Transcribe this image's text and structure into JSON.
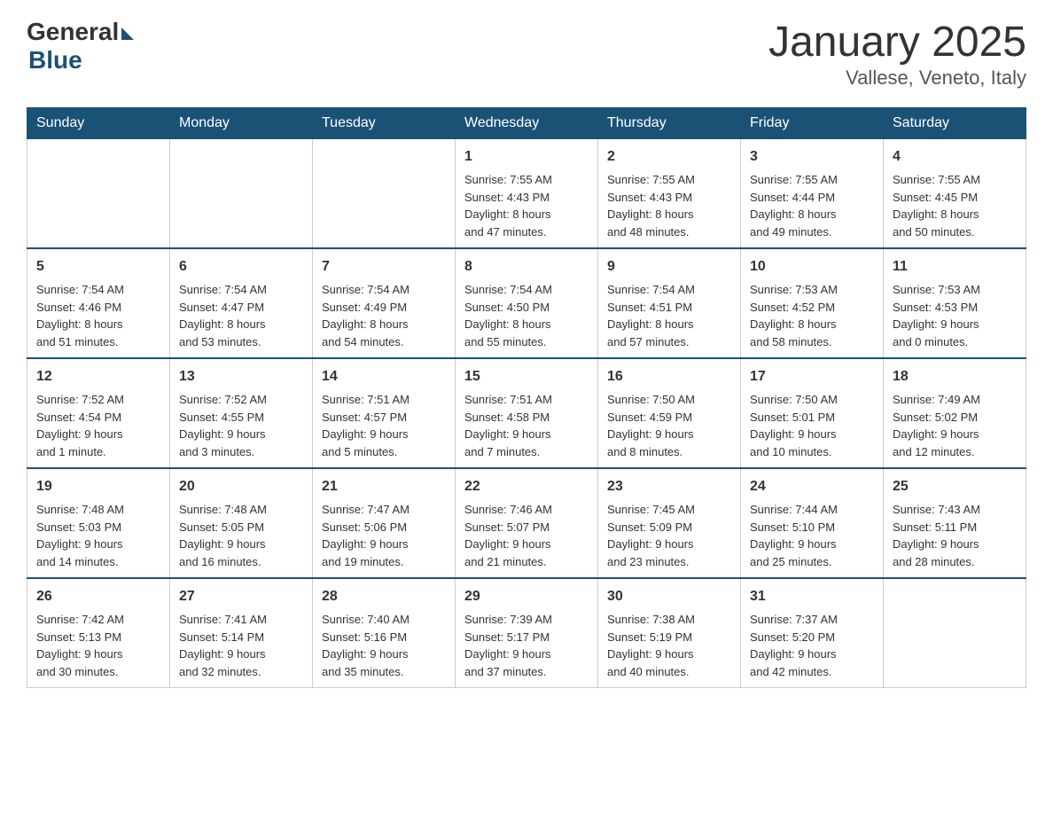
{
  "logo": {
    "general": "General",
    "blue": "Blue"
  },
  "title": "January 2025",
  "subtitle": "Vallese, Veneto, Italy",
  "days": [
    "Sunday",
    "Monday",
    "Tuesday",
    "Wednesday",
    "Thursday",
    "Friday",
    "Saturday"
  ],
  "weeks": [
    [
      {
        "day": "",
        "info": ""
      },
      {
        "day": "",
        "info": ""
      },
      {
        "day": "",
        "info": ""
      },
      {
        "day": "1",
        "info": "Sunrise: 7:55 AM\nSunset: 4:43 PM\nDaylight: 8 hours\nand 47 minutes."
      },
      {
        "day": "2",
        "info": "Sunrise: 7:55 AM\nSunset: 4:43 PM\nDaylight: 8 hours\nand 48 minutes."
      },
      {
        "day": "3",
        "info": "Sunrise: 7:55 AM\nSunset: 4:44 PM\nDaylight: 8 hours\nand 49 minutes."
      },
      {
        "day": "4",
        "info": "Sunrise: 7:55 AM\nSunset: 4:45 PM\nDaylight: 8 hours\nand 50 minutes."
      }
    ],
    [
      {
        "day": "5",
        "info": "Sunrise: 7:54 AM\nSunset: 4:46 PM\nDaylight: 8 hours\nand 51 minutes."
      },
      {
        "day": "6",
        "info": "Sunrise: 7:54 AM\nSunset: 4:47 PM\nDaylight: 8 hours\nand 53 minutes."
      },
      {
        "day": "7",
        "info": "Sunrise: 7:54 AM\nSunset: 4:49 PM\nDaylight: 8 hours\nand 54 minutes."
      },
      {
        "day": "8",
        "info": "Sunrise: 7:54 AM\nSunset: 4:50 PM\nDaylight: 8 hours\nand 55 minutes."
      },
      {
        "day": "9",
        "info": "Sunrise: 7:54 AM\nSunset: 4:51 PM\nDaylight: 8 hours\nand 57 minutes."
      },
      {
        "day": "10",
        "info": "Sunrise: 7:53 AM\nSunset: 4:52 PM\nDaylight: 8 hours\nand 58 minutes."
      },
      {
        "day": "11",
        "info": "Sunrise: 7:53 AM\nSunset: 4:53 PM\nDaylight: 9 hours\nand 0 minutes."
      }
    ],
    [
      {
        "day": "12",
        "info": "Sunrise: 7:52 AM\nSunset: 4:54 PM\nDaylight: 9 hours\nand 1 minute."
      },
      {
        "day": "13",
        "info": "Sunrise: 7:52 AM\nSunset: 4:55 PM\nDaylight: 9 hours\nand 3 minutes."
      },
      {
        "day": "14",
        "info": "Sunrise: 7:51 AM\nSunset: 4:57 PM\nDaylight: 9 hours\nand 5 minutes."
      },
      {
        "day": "15",
        "info": "Sunrise: 7:51 AM\nSunset: 4:58 PM\nDaylight: 9 hours\nand 7 minutes."
      },
      {
        "day": "16",
        "info": "Sunrise: 7:50 AM\nSunset: 4:59 PM\nDaylight: 9 hours\nand 8 minutes."
      },
      {
        "day": "17",
        "info": "Sunrise: 7:50 AM\nSunset: 5:01 PM\nDaylight: 9 hours\nand 10 minutes."
      },
      {
        "day": "18",
        "info": "Sunrise: 7:49 AM\nSunset: 5:02 PM\nDaylight: 9 hours\nand 12 minutes."
      }
    ],
    [
      {
        "day": "19",
        "info": "Sunrise: 7:48 AM\nSunset: 5:03 PM\nDaylight: 9 hours\nand 14 minutes."
      },
      {
        "day": "20",
        "info": "Sunrise: 7:48 AM\nSunset: 5:05 PM\nDaylight: 9 hours\nand 16 minutes."
      },
      {
        "day": "21",
        "info": "Sunrise: 7:47 AM\nSunset: 5:06 PM\nDaylight: 9 hours\nand 19 minutes."
      },
      {
        "day": "22",
        "info": "Sunrise: 7:46 AM\nSunset: 5:07 PM\nDaylight: 9 hours\nand 21 minutes."
      },
      {
        "day": "23",
        "info": "Sunrise: 7:45 AM\nSunset: 5:09 PM\nDaylight: 9 hours\nand 23 minutes."
      },
      {
        "day": "24",
        "info": "Sunrise: 7:44 AM\nSunset: 5:10 PM\nDaylight: 9 hours\nand 25 minutes."
      },
      {
        "day": "25",
        "info": "Sunrise: 7:43 AM\nSunset: 5:11 PM\nDaylight: 9 hours\nand 28 minutes."
      }
    ],
    [
      {
        "day": "26",
        "info": "Sunrise: 7:42 AM\nSunset: 5:13 PM\nDaylight: 9 hours\nand 30 minutes."
      },
      {
        "day": "27",
        "info": "Sunrise: 7:41 AM\nSunset: 5:14 PM\nDaylight: 9 hours\nand 32 minutes."
      },
      {
        "day": "28",
        "info": "Sunrise: 7:40 AM\nSunset: 5:16 PM\nDaylight: 9 hours\nand 35 minutes."
      },
      {
        "day": "29",
        "info": "Sunrise: 7:39 AM\nSunset: 5:17 PM\nDaylight: 9 hours\nand 37 minutes."
      },
      {
        "day": "30",
        "info": "Sunrise: 7:38 AM\nSunset: 5:19 PM\nDaylight: 9 hours\nand 40 minutes."
      },
      {
        "day": "31",
        "info": "Sunrise: 7:37 AM\nSunset: 5:20 PM\nDaylight: 9 hours\nand 42 minutes."
      },
      {
        "day": "",
        "info": ""
      }
    ]
  ]
}
